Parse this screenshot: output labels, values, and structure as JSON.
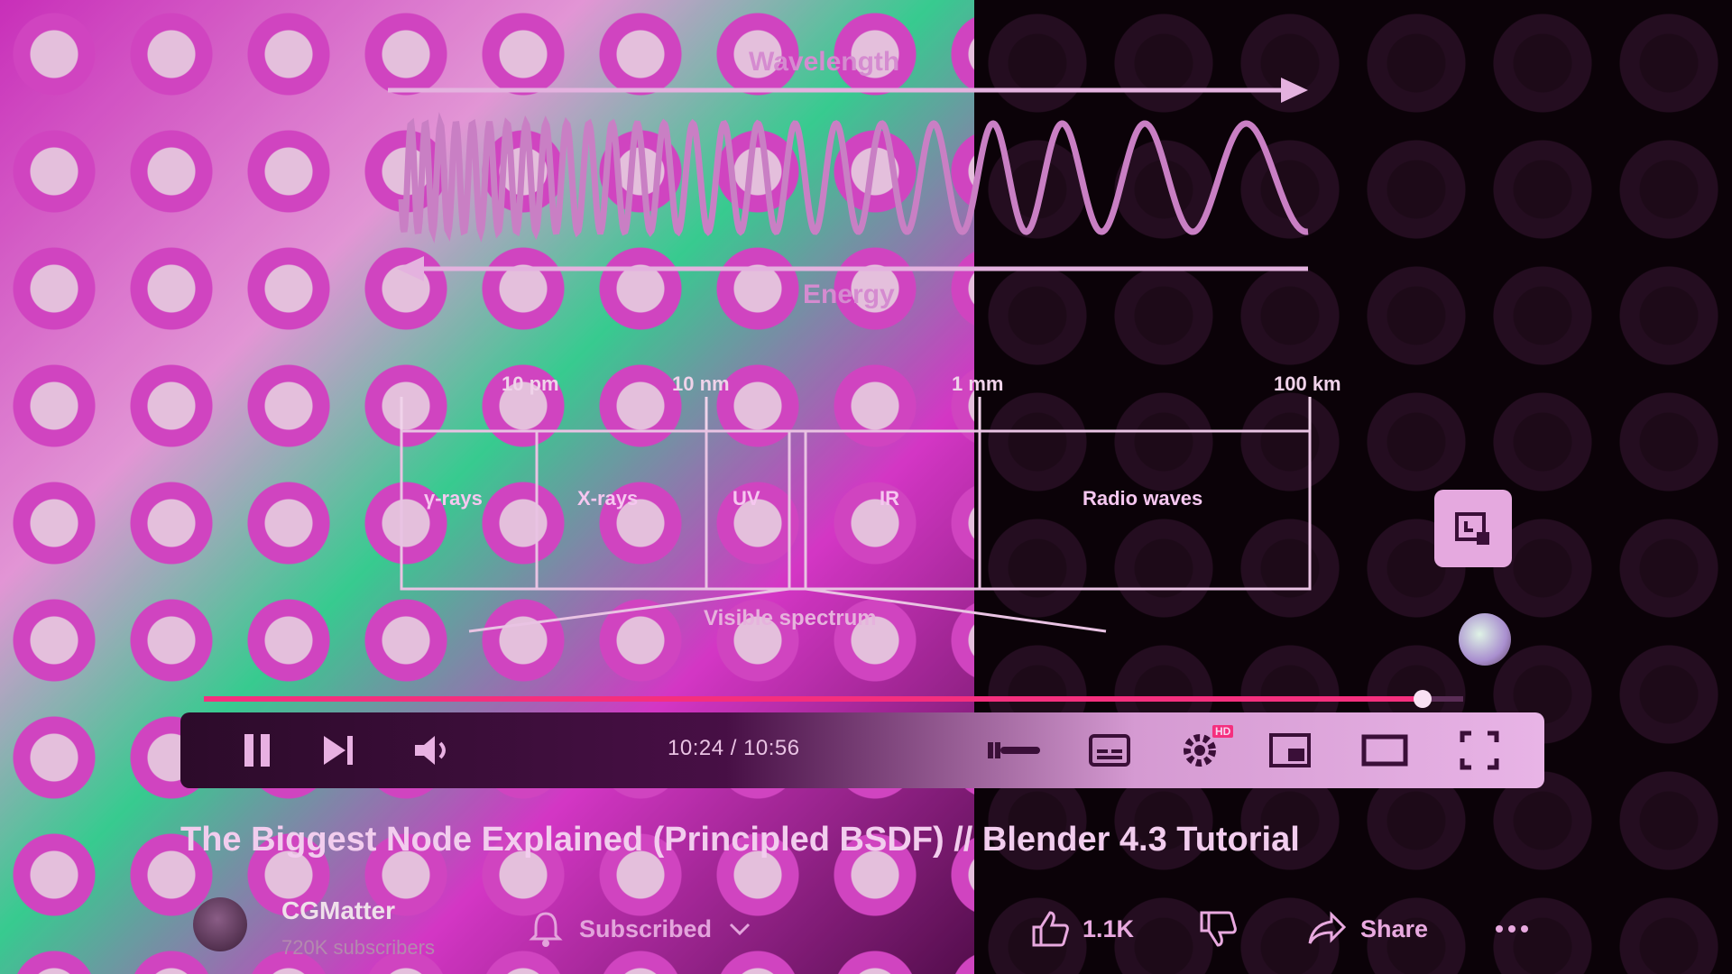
{
  "video": {
    "diagram": {
      "wavelength_label": "Wavelength",
      "energy_label": "Energy",
      "scale_labels": [
        "10 pm",
        "10 nm",
        "1 mm",
        "100 km"
      ],
      "bands": [
        "γ-rays",
        "X-rays",
        "UV",
        "IR",
        "Radio waves"
      ],
      "visible_label": "Visible spectrum"
    },
    "progress": 0.968
  },
  "player": {
    "time_current": "10:24",
    "time_total": "10:56",
    "time_display": "10:24 / 10:56",
    "quality_badge": "HD",
    "controls": [
      "pause-icon",
      "next-icon",
      "volume-icon",
      "autoplay-toggle",
      "subtitles-icon",
      "settings-icon",
      "miniplayer-icon",
      "theater-icon",
      "fullscreen-icon"
    ]
  },
  "title": "The Biggest Node Explained (Principled BSDF) // Blender 4.3 Tutorial",
  "channel": {
    "name": "CGMatter",
    "subscribers": "720K subscribers",
    "subscribe_label": "Subscribed"
  },
  "actions": {
    "likes": "1.1K",
    "share_label": "Share"
  },
  "colors": {
    "accent": "#f52f7e",
    "text": "#f2cdee",
    "background": "#0b0208"
  }
}
